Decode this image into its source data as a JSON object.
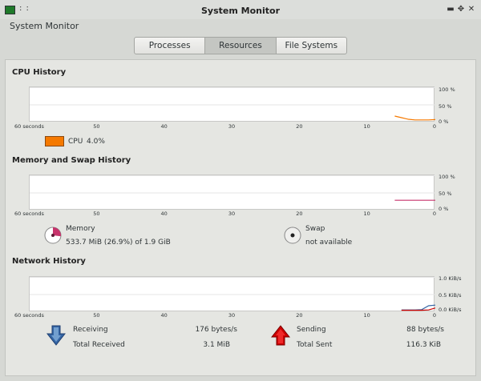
{
  "window": {
    "title": "System Monitor"
  },
  "header": {
    "label": "System Monitor"
  },
  "tabs": [
    {
      "label": "Processes",
      "active": false
    },
    {
      "label": "Resources",
      "active": true
    },
    {
      "label": "File Systems",
      "active": false
    }
  ],
  "x_axis_ticks": [
    "60 seconds",
    "50",
    "40",
    "30",
    "20",
    "10",
    "0"
  ],
  "cpu": {
    "title": "CPU History",
    "y_ticks": [
      "100 %",
      "50 %",
      "0 %"
    ],
    "legend_name": "CPU",
    "legend_value": "4.0%",
    "color": "#f57900",
    "chart_data": {
      "type": "line",
      "x": [
        6,
        5,
        4,
        3,
        2,
        1,
        0
      ],
      "values": [
        15,
        10,
        5,
        3,
        3,
        3,
        4
      ],
      "ylim": [
        0,
        100
      ],
      "xlim": [
        60,
        0
      ]
    }
  },
  "memory": {
    "title": "Memory and Swap History",
    "y_ticks": [
      "100 %",
      "50 %",
      "0 %"
    ],
    "memory_label": "Memory",
    "memory_value": "533.7 MiB (26.9%) of 1.9 GiB",
    "memory_color": "#c7336b",
    "memory_percent": 26.9,
    "swap_label": "Swap",
    "swap_value": "not available",
    "chart_data": {
      "type": "line",
      "x": [
        6,
        0
      ],
      "values": [
        26.9,
        26.9
      ],
      "ylim": [
        0,
        100
      ],
      "xlim": [
        60,
        0
      ]
    }
  },
  "network": {
    "title": "Network History",
    "y_ticks": [
      "1.0 KiB/s",
      "0.5 KiB/s",
      "0.0 KiB/s"
    ],
    "receiving_label": "Receiving",
    "receiving_value": "176 bytes/s",
    "total_received_label": "Total Received",
    "total_received_value": "3.1 MiB",
    "sending_label": "Sending",
    "sending_value": "88 bytes/s",
    "total_sent_label": "Total Sent",
    "total_sent_value": "116.3 KiB",
    "receiving_color": "#3465a4",
    "sending_color": "#cc0000",
    "chart_data": {
      "type": "line",
      "xlim": [
        60,
        0
      ],
      "ylim": [
        0,
        1.0
      ],
      "series": [
        {
          "color": "#3465a4",
          "x": [
            5,
            4,
            3,
            2,
            1,
            0
          ],
          "values": [
            0.02,
            0.02,
            0.02,
            0.03,
            0.15,
            0.17
          ]
        },
        {
          "color": "#cc0000",
          "x": [
            5,
            4,
            3,
            2,
            1,
            0
          ],
          "values": [
            0.01,
            0.01,
            0.01,
            0.01,
            0.02,
            0.08
          ]
        }
      ]
    }
  }
}
